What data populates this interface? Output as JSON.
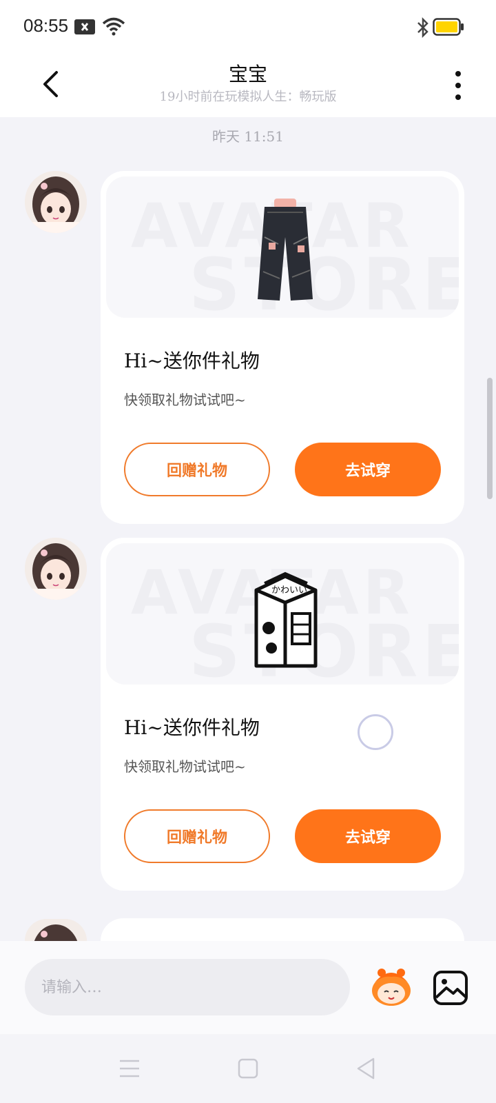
{
  "status_bar": {
    "time": "08:55"
  },
  "header": {
    "title": "宝宝",
    "subtitle": "19小时前在玩模拟人生：畅玩版"
  },
  "timestamp": "昨天 11:51",
  "messages": [
    {
      "gift_item": "pants",
      "watermark_top": "AVATAR",
      "watermark_bottom": "STORE",
      "title": "Hi~送你件礼物",
      "desc": "快领取礼物试试吧~",
      "return_gift_label": "回赠礼物",
      "try_on_label": "去试穿"
    },
    {
      "gift_item": "milk-carton",
      "carton_text": "かわいい",
      "watermark_top": "AVATAR",
      "watermark_bottom": "STORE",
      "title": "Hi~送你件礼物",
      "desc": "快领取礼物试试吧~",
      "return_gift_label": "回赠礼物",
      "try_on_label": "去试穿"
    }
  ],
  "input": {
    "placeholder": "请输入…"
  },
  "colors": {
    "accent": "#ff7419",
    "outline": "#f07a2a",
    "background": "#f3f3f8"
  },
  "icons": [
    "back-icon",
    "more-icon",
    "wifi-icon",
    "bluetooth-icon",
    "battery-icon",
    "mascot-icon",
    "image-icon",
    "menu-nav-icon",
    "home-nav-icon",
    "back-nav-icon"
  ]
}
